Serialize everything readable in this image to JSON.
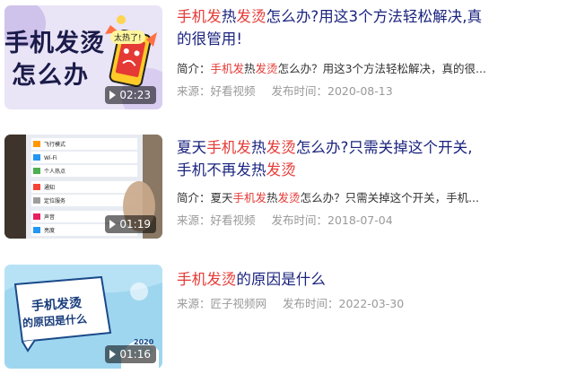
{
  "results": [
    {
      "title_parts": [
        {
          "text": "手机发",
          "hl": true
        },
        {
          "text": "热",
          "hl": false
        },
        {
          "text": "发烫",
          "hl": true
        },
        {
          "text": "怎么办?用这3个方法轻松解决,真",
          "hl": false
        }
      ],
      "title_line2": "的很管用!",
      "summary_parts": [
        {
          "text": "简介：",
          "hl": false
        },
        {
          "text": "手机发",
          "hl": true
        },
        {
          "text": "热",
          "hl": false
        },
        {
          "text": "发烫",
          "hl": true
        },
        {
          "text": "怎么办？用这3个方法轻松解决，真的很...",
          "hl": false
        }
      ],
      "source": "来源：好看视频",
      "date": "发布时间：2020-08-13",
      "duration": "02:23",
      "thumb_text_1": "手机发烫",
      "thumb_text_2": "怎么办",
      "thumb_badge": "太热了!"
    },
    {
      "title_parts": [
        {
          "text": "夏天",
          "hl": false
        },
        {
          "text": "手机发",
          "hl": true
        },
        {
          "text": "热",
          "hl": false
        },
        {
          "text": "发烫",
          "hl": true
        },
        {
          "text": "怎么办?只需关掉这个开关,",
          "hl": false
        }
      ],
      "title_line2_parts": [
        {
          "text": "手机不再发热",
          "hl": false
        },
        {
          "text": "发烫",
          "hl": true
        }
      ],
      "summary_parts": [
        {
          "text": "简介：夏天",
          "hl": false
        },
        {
          "text": "手机发",
          "hl": true
        },
        {
          "text": "热",
          "hl": false
        },
        {
          "text": "发烫",
          "hl": true
        },
        {
          "text": "怎么办？只需关掉这个开关，手机...",
          "hl": false
        }
      ],
      "source": "来源：好看视频",
      "date": "发布时间：2018-07-04",
      "duration": "01:19",
      "settings_rows": [
        "飞行模式",
        "Wi-Fi",
        "个人热点",
        "通知",
        "定位服务",
        "声音",
        "亮度"
      ]
    },
    {
      "title_parts": [
        {
          "text": "手机发烫",
          "hl": true
        },
        {
          "text": "的原因是什么",
          "hl": false
        }
      ],
      "source": "来源：匠子视频网",
      "date": "发布时间：2022-03-30",
      "duration": "01:16",
      "thumb_text_1": "手机发烫",
      "thumb_text_2": "的原因是什么",
      "thumb_badge": "2020"
    }
  ]
}
